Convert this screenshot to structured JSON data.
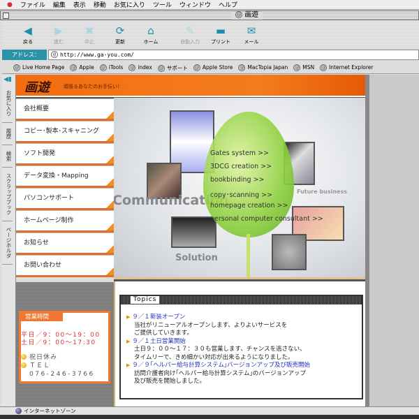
{
  "menubar": {
    "items": [
      "ファイル",
      "編集",
      "表示",
      "移動",
      "お気に入り",
      "ツール",
      "ウィンドウ",
      "ヘルプ"
    ]
  },
  "window": {
    "title": "画遊"
  },
  "toolbar": {
    "buttons": [
      {
        "label": "戻る",
        "icon": "back-arrow",
        "enabled": true
      },
      {
        "label": "進む",
        "icon": "forward-arrow",
        "enabled": false
      },
      {
        "label": "中止",
        "icon": "stop-x",
        "enabled": false
      },
      {
        "label": "更新",
        "icon": "refresh",
        "enabled": true
      },
      {
        "label": "ホーム",
        "icon": "home",
        "enabled": true
      },
      {
        "label": "自動入力",
        "icon": "autofill",
        "enabled": false
      },
      {
        "label": "プリント",
        "icon": "printer",
        "enabled": true
      },
      {
        "label": "メール",
        "icon": "mail",
        "enabled": true
      }
    ]
  },
  "address": {
    "label": "アドレス：",
    "url": "http://www.ga-you.com/"
  },
  "favorites": [
    "Live Home Page",
    "Apple",
    "iTools",
    "index",
    "サポート",
    "Apple Store",
    "MacTopia Japan",
    "MSN",
    "Internet Explorer"
  ],
  "explorer_tabs": [
    "お気に入り",
    "履歴",
    "検索",
    "スクラップブック",
    "ページホルダ"
  ],
  "site": {
    "logo": "画遊",
    "tagline": "頑張るあなたのお手伝い！",
    "nav": [
      "会社概要",
      "コピー･製本･スキャニング",
      "ソフト開発",
      "データ変換・Mapping",
      "パソコンサポート",
      "ホームページ制作",
      "お知らせ",
      "お問い合わせ"
    ],
    "hero": {
      "links": [
        "Gates system >>",
        "3DCG creation >>",
        "bookbinding >>",
        "copy･scanning >>",
        "homepage creation >>",
        "personal computer consultant >>"
      ],
      "words": [
        "Communication",
        "Solution",
        "Future business"
      ]
    },
    "hours": {
      "title": "営業時間",
      "weekday": "平日／9：00〜19：00",
      "weekend": "土日／9：00〜17:30",
      "holiday": "祝日休み",
      "tel_label": "ＴＥＬ",
      "tel": "076-246-3766"
    },
    "topics": {
      "title": "Topics",
      "items": [
        {
          "title": "９／１新装オープン",
          "body": [
            "当社がリニューアルオープンします、よりよいサービスを",
            "ご提供していきます。"
          ]
        },
        {
          "title": "９／１土日営業開始",
          "body": [
            "土日９：００〜１７：３０も営業します、チャンスを逃さない、",
            "タイムリーで、きめ細かい対応が出来るようになりました。"
          ]
        },
        {
          "title": "９／９｢ヘルパー給与計算システム｣バージョンアップ及び販売開始",
          "body": [
            "訪問介護者向け｢ヘルパー給与計算システム｣のバージョンアップ",
            "及び販売を開始しました。"
          ]
        }
      ]
    }
  },
  "status": {
    "zone": "インターネットゾーン"
  },
  "colors": {
    "accent": "#f07830",
    "toolbar_icon": "#1b8fa8",
    "link": "#2233bb"
  }
}
